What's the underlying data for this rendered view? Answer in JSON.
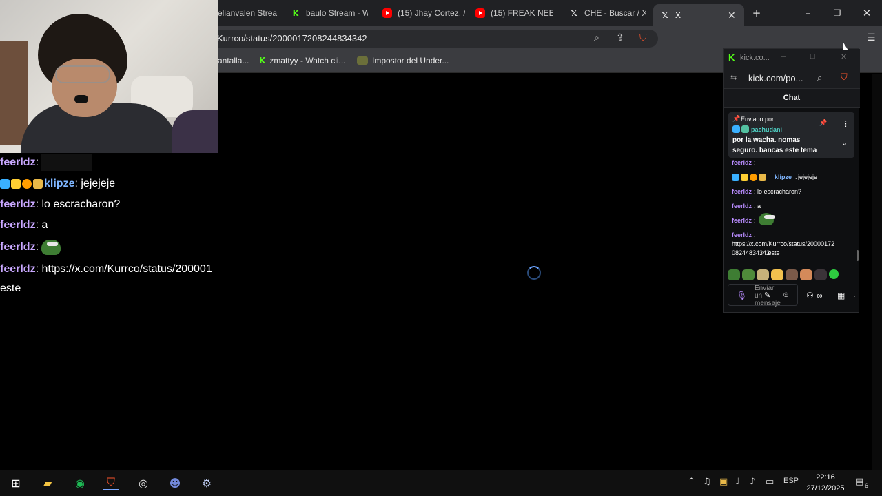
{
  "tabs": [
    {
      "label": "elianvalen Strea",
      "icon": "kick-icon"
    },
    {
      "label": "baulo Stream - W",
      "icon": "kick-icon"
    },
    {
      "label": "(15) Jhay Cortez, /",
      "icon": "youtube-icon"
    },
    {
      "label": "(15) FREAK NEEK",
      "icon": "youtube-icon"
    },
    {
      "label": "CHE - Buscar / X",
      "icon": "x-icon"
    },
    {
      "label": "X",
      "icon": "x-icon",
      "active": true
    }
  ],
  "address": {
    "url": "Kurrco/status/2000017208244834342"
  },
  "bookmarks": [
    {
      "label": "antalla..."
    },
    {
      "label": "zmattyy - Watch cli...",
      "icon": "kick-icon"
    },
    {
      "label": "Impostor del Under...",
      "icon": "game-icon"
    }
  ],
  "overlay_chat": {
    "lines": [
      {
        "user": "feerldz",
        "sep": ":",
        "text": ""
      },
      {
        "user": "klipze",
        "sep": ":",
        "text": " jejejeje"
      },
      {
        "user": "feerldz",
        "sep": ":",
        "text": " lo escracharon?"
      },
      {
        "user": "feerldz",
        "sep": ":",
        "text": " a"
      },
      {
        "user": "feerldz",
        "sep": ":",
        "text": ""
      },
      {
        "user": "feerldz",
        "sep": ":",
        "text": " https://x.com/Kurrco/status/200001"
      }
    ],
    "wrap_text": "este"
  },
  "popup": {
    "title": "kick.co...",
    "address": "kick.com/po...",
    "chat_heading": "Chat",
    "pinned": {
      "label": "Enviado por",
      "user": "pachudani",
      "text_line1": "por la wacha. nomas",
      "text_line2": "seguro. bancas este tema"
    },
    "messages": [
      {
        "user": "feerldz",
        "text": ""
      },
      {
        "user": "klipze",
        "text": "jejejeje"
      },
      {
        "user": "feerldz",
        "text": "lo escracharon?"
      },
      {
        "user": "feerldz",
        "text": "a"
      },
      {
        "user": "feerldz",
        "text": ""
      },
      {
        "user": "feerldz",
        "text": ""
      }
    ],
    "link_line1": "https://x.com/Kurrco/status/20000172",
    "link_line2": "08244834342",
    "link_tail": " este",
    "input_placeholder_1": "Enviar",
    "input_placeholder_2": "un",
    "input_placeholder_3": "mensaje"
  },
  "taskbar": {
    "lang": "ESP",
    "time": "22:16",
    "date": "27/12/2025",
    "notifications": "6"
  }
}
